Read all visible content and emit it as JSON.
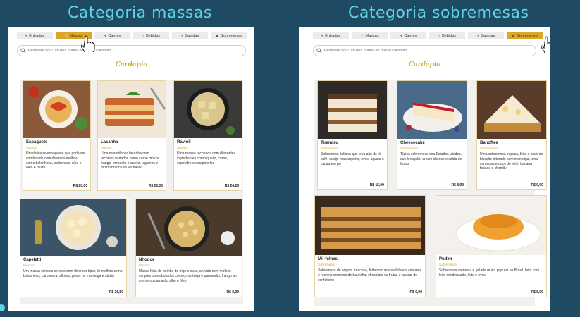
{
  "titles": {
    "left": "Categoria massas",
    "right": "Categoria sobremesas"
  },
  "tabs": [
    {
      "label": "Entradas",
      "icon": "shrimp-icon"
    },
    {
      "label": "Massas",
      "icon": "pasta-icon"
    },
    {
      "label": "Carnes",
      "icon": "meat-icon"
    },
    {
      "label": "Bebidas",
      "icon": "drink-icon"
    },
    {
      "label": "Saladas",
      "icon": "salad-icon"
    },
    {
      "label": "Sobremesas",
      "icon": "dessert-icon"
    }
  ],
  "search": {
    "placeholder": "Pesquise aqui um dos pratos do nosso cardápio"
  },
  "section_title": "Cardápio",
  "left_active_tab": "Massas",
  "right_active_tab": "Sobremesas",
  "massas": [
    {
      "name": "Espaguete",
      "category": "Massas",
      "description": "Um delicioso espaguete que pode ser combinado com diversos molhos, como bolonhesa, carbonara, alho e óleo e pesto",
      "price": "R$ 20,00"
    },
    {
      "name": "Lasanha",
      "category": "Massas",
      "description": "Uma maravilhosa lasanha com recheios variados como carne moída, frango, presunto e queijo, legumos e molho branco ou vermelho",
      "price": "R$ 25,00"
    },
    {
      "name": "Ravioli",
      "category": "Massas",
      "description": "Uma massa recheada com diferentes ingredientes como queijo, carne, espinafre ou cogumelos",
      "price": "R$ 24,25"
    },
    {
      "name": "Capeletti",
      "category": "Massas",
      "description": "Um massa simples servido com diversos tipos de molhos como bolonhesa, carbonara, alfredo, pesto ou manteiga e sálvia",
      "price": "R$ 26,50"
    },
    {
      "name": "Nhoque",
      "category": "Massas",
      "description": "Massa feita de farinha de trigo e ovos, servido com molhos simples ou elaborados como, manteiga e parmesão, frango ao creme ou camarão alho e óleo",
      "price": "R$ 8,99"
    }
  ],
  "sobremesas": [
    {
      "name": "Tiramisu",
      "category": "Sobremesas",
      "description": "Sobremesa italiana que leva pão de ló, café, queijo mascarpone, ovos, açucar e cacau em pó",
      "price": "R$ 15,99"
    },
    {
      "name": "Cheesecake",
      "category": "Sobremesas",
      "description": "Típica sobremesa dos Estados Unidos, que leva pão, cream cheese e calda de frutas",
      "price": "R$ 8,99"
    },
    {
      "name": "Banoffee",
      "category": "Sobremesas",
      "description": "Uma sobremesa inglesa, feita a base de biscoito triturado com manteiga, uma camada de doce de leite, banana fatiada e chantily",
      "price": "R$ 9,99"
    },
    {
      "name": "Mil-folhas",
      "category": "Sobremesas",
      "description": "Sobremesa de origem francesa, feita com massa folhada crocante e recheio cremoso de baunilha, chocolate ou frutas e açucar de confeiteiro",
      "price": "R$ 9,99"
    },
    {
      "name": "Pudim",
      "category": "Sobremesas",
      "description": "Sobremesa cremosa e gelada muito popular no Brasil, feita com leite condensado, leite e ovos",
      "price": "R$ 5,99"
    }
  ],
  "colors": {
    "background": "#1e4a63",
    "title": "#5fd4e6",
    "accent": "#d9a82a"
  }
}
